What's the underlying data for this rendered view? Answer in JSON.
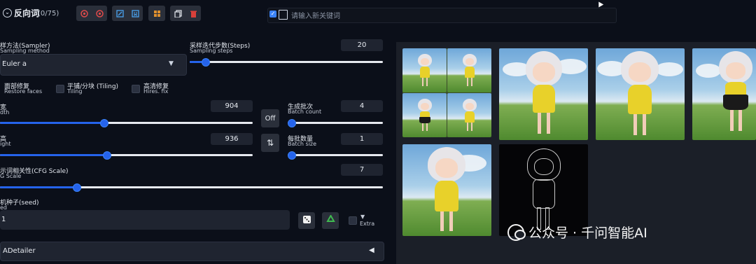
{
  "negative_prompt": {
    "title": "反向词",
    "count": "(0/75)"
  },
  "keyword_input": {
    "placeholder": "请输入新关键词"
  },
  "icons": {
    "group1": [
      "red-circle-icon",
      "red-circle-icon"
    ],
    "group2": [
      "edit-icon",
      "bookmark-icon"
    ],
    "group3": [
      "grid-icon"
    ],
    "group4": [
      "copy-icon",
      "trash-icon"
    ]
  },
  "sampler": {
    "label_cn": "样方法(Sampler)",
    "label_en": "Sampling method",
    "value": "Euler a"
  },
  "steps": {
    "label_cn": "采样迭代步数(Steps)",
    "label_en": "Sampling steps",
    "value": "20",
    "fraction": 0.08
  },
  "checkboxes": [
    {
      "cn": "面部修复",
      "en": "Restore faces"
    },
    {
      "cn": "平铺/分块 (Tiling)",
      "en": "Tiling"
    },
    {
      "cn": "高清修复",
      "en": "Hires. fix"
    }
  ],
  "width": {
    "label_cn": "宽",
    "label_en": "dth",
    "value": "904",
    "fraction": 0.41
  },
  "height": {
    "label_cn": "高",
    "label_en": "ight",
    "value": "936",
    "fraction": 0.42
  },
  "batch_count": {
    "label_cn": "生成批次",
    "label_en": "Batch count",
    "value": "4",
    "fraction": 0.03
  },
  "batch_size": {
    "label_cn": "每批数量",
    "label_en": "Batch size",
    "value": "1",
    "fraction": 0.0
  },
  "swap_button": {
    "label": "⇅"
  },
  "off_button": {
    "label": "Off"
  },
  "cfg": {
    "label_cn": "示词相关性(CFG Scale)",
    "label_en": "G Scale",
    "value": "7",
    "fraction": 0.2
  },
  "seed": {
    "label_cn": "机种子(seed)",
    "label_en": "ed",
    "value": "1"
  },
  "extra": {
    "label": "Extra",
    "arrow": "▼"
  },
  "adetailer": {
    "label": "ADetailer",
    "arrow": "◀"
  },
  "watermark": {
    "text": "公众号 · 千问智能AI"
  }
}
